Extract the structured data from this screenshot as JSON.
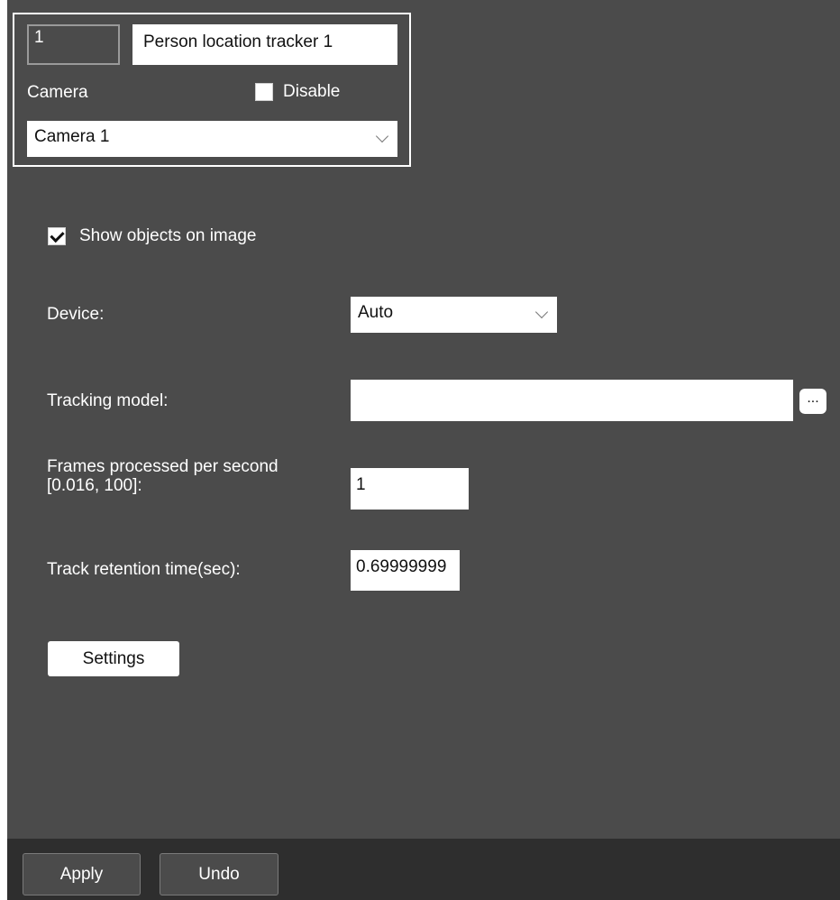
{
  "object": {
    "id": "1",
    "name": "Person location tracker 1",
    "camera_label": "Camera",
    "disable_label": "Disable",
    "disable_checked": false,
    "camera_value": "Camera 1"
  },
  "settings": {
    "show_objects_label": "Show objects on image",
    "show_objects_checked": true,
    "device_label": "Device:",
    "device_value": "Auto",
    "tracking_model_label": "Tracking model:",
    "tracking_model_value": "",
    "browse_label": "...",
    "fps_label_line1": "Frames processed per second",
    "fps_label_line2": "[0.016, 100]:",
    "fps_value": "1",
    "retention_label": "Track retention time(sec):",
    "retention_value": "0.69999999",
    "settings_button": "Settings"
  },
  "footer": {
    "apply_label": "Apply",
    "undo_label": "Undo"
  }
}
